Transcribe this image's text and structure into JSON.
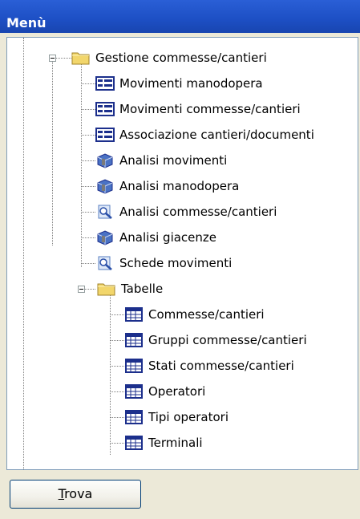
{
  "window": {
    "title": "Menù"
  },
  "tree": {
    "folders": [
      {
        "label": "Gestione commesse/cantieri",
        "icon": "folder-icon"
      },
      {
        "label": "Tabelle",
        "icon": "folder-icon"
      }
    ],
    "gestione_items": [
      {
        "label": "Movimenti manodopera",
        "icon": "form-icon"
      },
      {
        "label": "Movimenti commesse/cantieri",
        "icon": "form-icon"
      },
      {
        "label": "Associazione cantieri/documenti",
        "icon": "form-icon"
      },
      {
        "label": "Analisi movimenti",
        "icon": "analysis-cube-icon"
      },
      {
        "label": "Analisi manodopera",
        "icon": "analysis-cube-icon"
      },
      {
        "label": "Analisi commesse/cantieri",
        "icon": "magnifier-report-icon"
      },
      {
        "label": "Analisi giacenze",
        "icon": "analysis-cube-icon"
      },
      {
        "label": "Schede movimenti",
        "icon": "magnifier-report-icon"
      }
    ],
    "tabelle_items": [
      {
        "label": "Commesse/cantieri",
        "icon": "table-icon"
      },
      {
        "label": "Gruppi commesse/cantieri",
        "icon": "table-icon"
      },
      {
        "label": "Stati commesse/cantieri",
        "icon": "table-icon"
      },
      {
        "label": "Operatori",
        "icon": "table-icon"
      },
      {
        "label": "Tipi operatori",
        "icon": "table-icon"
      },
      {
        "label": "Terminali",
        "icon": "table-icon"
      }
    ]
  },
  "buttons": {
    "trova_first": "T",
    "trova_rest": "rova"
  },
  "colors": {
    "titlebar": "#1d4fc4",
    "folder": "#f2d66b",
    "form_icon": "#1c2f8c",
    "table_icon": "#1c2f8c"
  }
}
